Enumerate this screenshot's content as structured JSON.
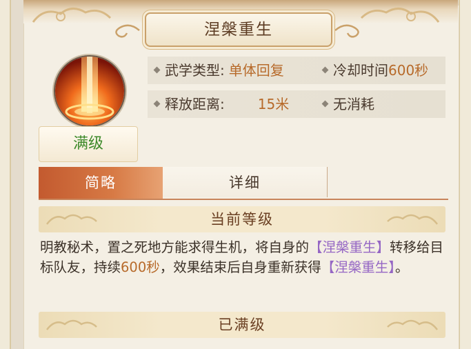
{
  "title": "涅槃重生",
  "skill_icon": "flame-pillar-icon",
  "level_label": "满级",
  "info": {
    "type_label": "武学类型:",
    "type_value": "单体回复",
    "cooldown_label": "冷却时间",
    "cooldown_value": "600秒",
    "range_label": "释放距离:",
    "range_value": "15米",
    "cost_value": "无消耗"
  },
  "tabs": [
    {
      "label": "简略",
      "active": true
    },
    {
      "label": "详细",
      "active": false
    }
  ],
  "current_level_header": "当前等级",
  "description": {
    "part1": "明教秘术，置之死地方能求得生机，将自身的",
    "skill_ref1": "【涅槃重生】",
    "part2": "转移给目标队友，持续",
    "duration": "600秒",
    "part3": "，效果结束后自身重新获得",
    "skill_ref2": "【涅槃重生】",
    "part4": "。"
  },
  "max_level_header": "已满级",
  "colors": {
    "accent_orange": "#b76a2a",
    "skill_purple": "#9566c4",
    "level_green": "#3e8a2b",
    "tab_active": "#c35a2f"
  }
}
